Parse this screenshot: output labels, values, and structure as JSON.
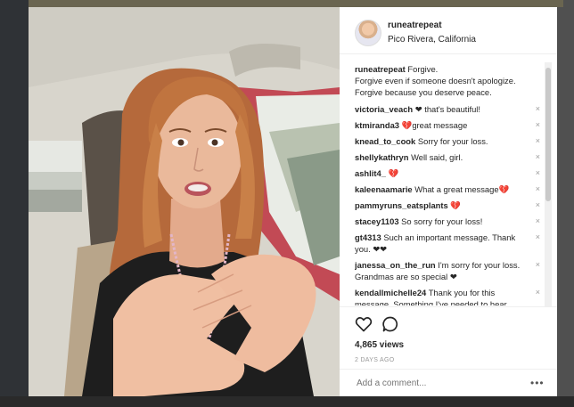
{
  "post": {
    "username": "runeatrepeat",
    "location": "Pico Rivera, California"
  },
  "caption": {
    "user": "runeatrepeat",
    "lines": [
      "Forgive.",
      "Forgive even if someone doesn't apologize.",
      "Forgive because you deserve peace."
    ]
  },
  "comments": [
    {
      "user": "victoria_veach",
      "text": "❤ that's beautiful!"
    },
    {
      "user": "ktmiranda3",
      "text": "💔great message"
    },
    {
      "user": "knead_to_cook",
      "text": "Sorry for your loss."
    },
    {
      "user": "shellykathryn",
      "text": "Well said, girl."
    },
    {
      "user": "ashlit4_",
      "text": "💔"
    },
    {
      "user": "kaleenaamarie",
      "text": "What a great message💔"
    },
    {
      "user": "pammyruns_eatsplants",
      "text": "💔"
    },
    {
      "user": "stacey1103",
      "text": "So sorry for your loss!"
    },
    {
      "user": "gt4313",
      "text": "Such an important message. Thank you. ❤❤"
    },
    {
      "user": "janessa_on_the_run",
      "text": "I'm sorry for your loss. Grandmas are so special ❤"
    },
    {
      "user": "kendallmichelle24",
      "text": "Thank you for this message. Something I've needed to hear"
    }
  ],
  "remove_glyph": "×",
  "stats": {
    "views": "4,865 views",
    "posted": "2 DAYS AGO"
  },
  "add_comment": {
    "placeholder": "Add a comment..."
  },
  "more_glyph": "•••",
  "icons": {
    "like": "heart-icon",
    "comment": "comment-bubble-icon",
    "more": "more-options-icon"
  }
}
